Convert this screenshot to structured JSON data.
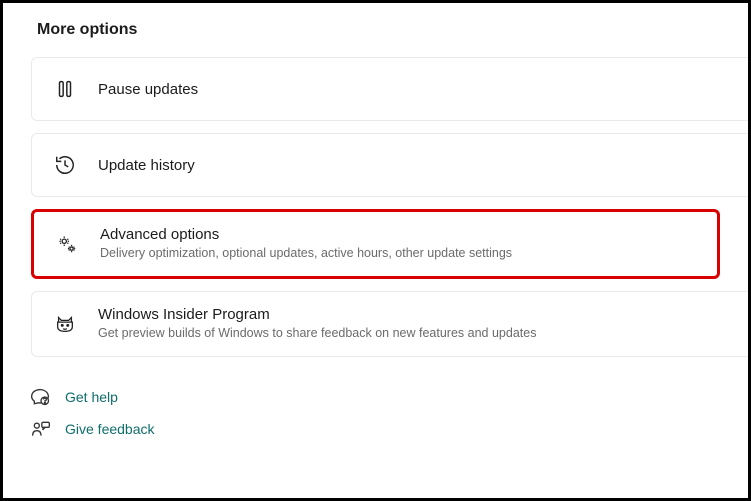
{
  "heading": "More options",
  "options": {
    "pause": {
      "title": "Pause updates"
    },
    "history": {
      "title": "Update history"
    },
    "advanced": {
      "title": "Advanced options",
      "subtitle": "Delivery optimization, optional updates, active hours, other update settings",
      "highlighted": true
    },
    "insider": {
      "title": "Windows Insider Program",
      "subtitle": "Get preview builds of Windows to share feedback on new features and updates"
    }
  },
  "footer": {
    "help": "Get help",
    "feedback": "Give feedback"
  }
}
